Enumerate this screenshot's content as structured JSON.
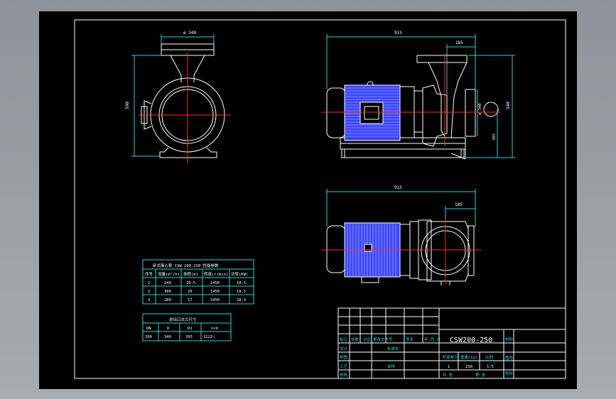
{
  "drawing": {
    "dims": {
      "side_width": "ø 340",
      "side_height": "590",
      "front_length": "915",
      "front_suction": "185",
      "front_height": "540",
      "front_flange": "ø 340",
      "front_center": "395",
      "plan_length": "915",
      "plan_offset": "185"
    }
  },
  "params_table": {
    "title": "卧式离心泵 CSW 200-250 性能参数",
    "headers": [
      "序号",
      "流量(m³/h)",
      "扬程(m)",
      "转速(r/min)",
      "功率(KW)"
    ],
    "rows": [
      [
        "1",
        "240",
        "20.5",
        "1450",
        "18.5"
      ],
      [
        "2",
        "300",
        "20",
        "1450",
        "18.5"
      ],
      [
        "3",
        "280",
        "17",
        "1450",
        "18.5"
      ]
    ]
  },
  "flange_table": {
    "title": "进出口法兰尺寸",
    "headers": [
      "DN",
      "D",
      "D1",
      "n×d"
    ],
    "row": [
      "200",
      "340",
      "295",
      "12ר22"
    ]
  },
  "title_block": {
    "drawing_name": "CSW200-250",
    "rev_labels": [
      "标记",
      "处数",
      "分区",
      "更改文件号",
      "签名",
      "年.月.日"
    ],
    "row_labels": [
      "设计",
      "制图",
      "工艺",
      "校核"
    ],
    "std_label": "标准化",
    "approve_label": "审核",
    "stage_label": "阶段标记",
    "weight_label": "重量(kg)",
    "scale_label": "比例",
    "qty": "1",
    "weight": "230",
    "scale": "1:5",
    "sheet_total": "共 张",
    "sheet_no": "第 张",
    "side_labels": [
      "材料",
      "图号",
      "零件"
    ]
  }
}
